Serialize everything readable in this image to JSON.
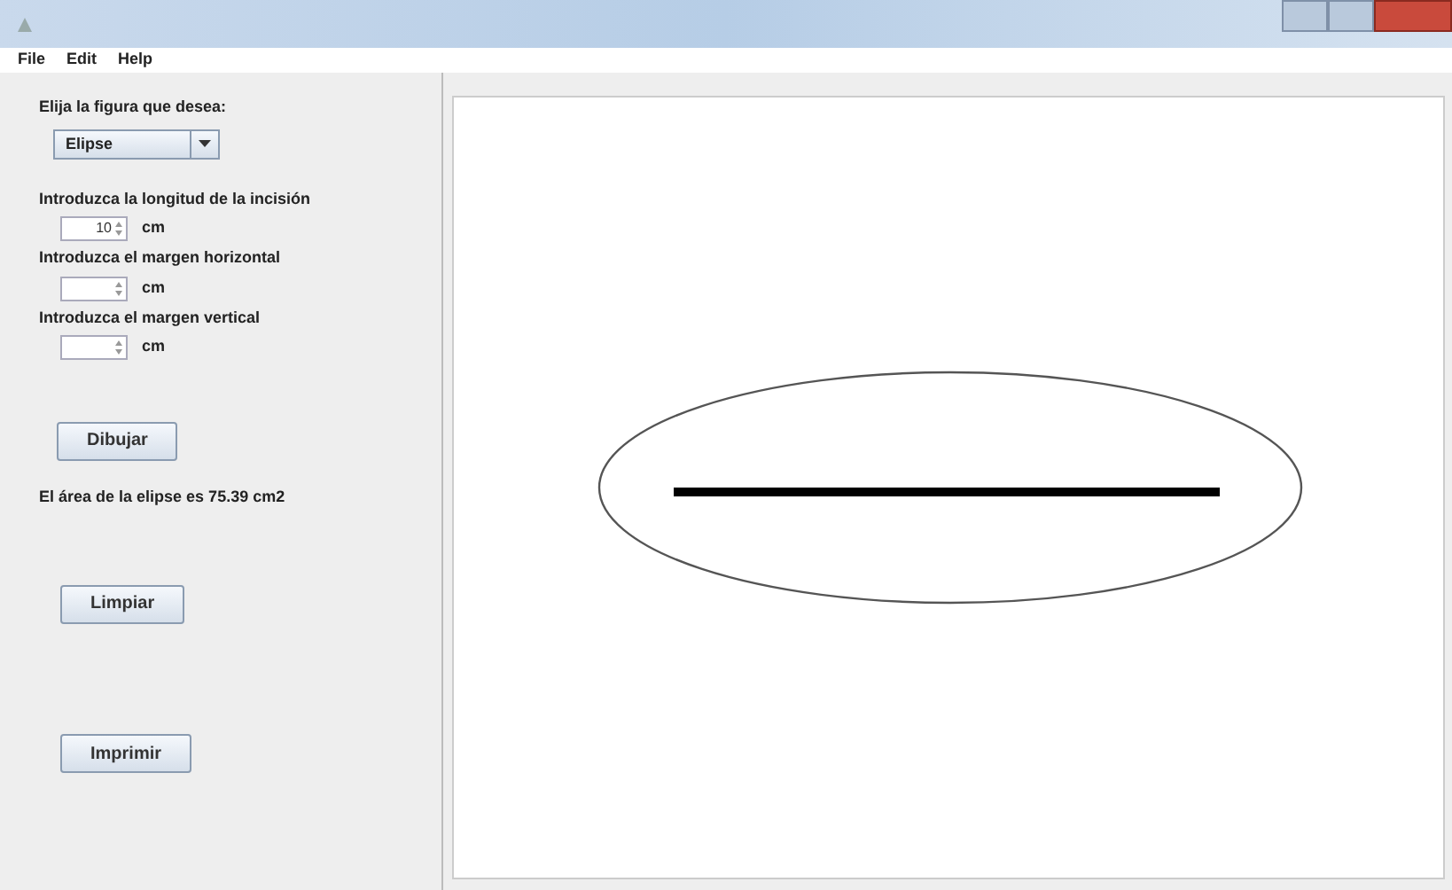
{
  "menu": [
    "File",
    "Edit",
    "Help"
  ],
  "shape_label": "Elija la figura que desea:",
  "shape_select": {
    "value": "Elipse"
  },
  "fields": [
    {
      "label": "Introduzca la longitud de la incisión",
      "value": "10",
      "unit": "cm"
    },
    {
      "label": "Introduzca el margen horizontal",
      "unit": "cm"
    },
    {
      "label": "Introduzca el margen vertical",
      "unit": "cm"
    }
  ],
  "draw_button": "Dibujar",
  "result": "El área de la elipse es 75.39 cm2",
  "clear_button": "Limpiar",
  "print_button": "Imprimir"
}
